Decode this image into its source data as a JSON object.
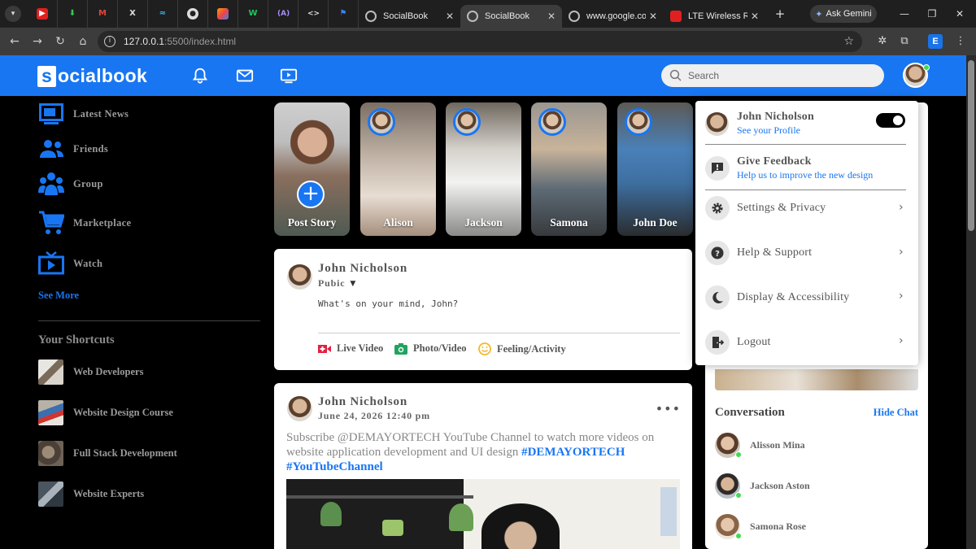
{
  "browser": {
    "tabs": [
      {
        "title": "SocialBook",
        "active": false
      },
      {
        "title": "SocialBook",
        "active": true
      },
      {
        "title": "www.google.com",
        "active": false
      },
      {
        "title": "LTE Wireless Rou",
        "active": false
      }
    ],
    "gemini_label": "Ask Gemini",
    "url_host": "127.0.0.1",
    "url_path": ":5500/index.html",
    "profile_letter": "E"
  },
  "nav": {
    "logo_letter": "s",
    "logo_rest": "ocialbook",
    "search_placeholder": "Search"
  },
  "sidebar": {
    "links": [
      {
        "label": "Latest News",
        "icon": "news-icon"
      },
      {
        "label": "Friends",
        "icon": "friends-icon"
      },
      {
        "label": "Group",
        "icon": "group-icon"
      },
      {
        "label": "Marketplace",
        "icon": "cart-icon"
      },
      {
        "label": "Watch",
        "icon": "watch-icon"
      }
    ],
    "see_more": "See More",
    "shortcuts_title": "Your Shortcuts",
    "shortcuts": [
      {
        "label": "Web Developers"
      },
      {
        "label": "Website Design Course"
      },
      {
        "label": "Full Stack Development"
      },
      {
        "label": "Website Experts"
      }
    ]
  },
  "stories": [
    {
      "name": "Post Story"
    },
    {
      "name": "Alison"
    },
    {
      "name": "Jackson"
    },
    {
      "name": "Samona"
    },
    {
      "name": "John Doe"
    }
  ],
  "composer": {
    "user": "John Nicholson",
    "privacy": "Pubic",
    "placeholder": "What's on your mind, John?",
    "actions": [
      {
        "label": "Live Video",
        "color": "#e41e3f"
      },
      {
        "label": "Photo/Video",
        "color": "#21a35f"
      },
      {
        "label": "Feeling/Activity",
        "color": "#f5b928"
      }
    ]
  },
  "post": {
    "user": "John Nicholson",
    "date": "June 24, 2026 12:40 pm",
    "text": "Subscribe @DEMAYORTECH YouTube Channel to watch more videos on website application development and UI design ",
    "tag1": "#DEMAYORTECH",
    "tag2": "#YouTubeChannel",
    "more": "•••"
  },
  "conversation": {
    "title": "Conversation",
    "hide_label": "Hide Chat",
    "contacts": [
      {
        "name": "Alisson Mina"
      },
      {
        "name": "Jackson Aston"
      },
      {
        "name": "Samona Rose"
      }
    ]
  },
  "menu": {
    "profile_name": "John Nicholson",
    "profile_link": "See your Profile",
    "dark_mode_on": true,
    "feedback_title": "Give Feedback",
    "feedback_sub": "Help us to improve the new design",
    "items": [
      {
        "label": "Settings & Privacy",
        "icon": "gear-icon"
      },
      {
        "label": "Help & Support",
        "icon": "help-icon"
      },
      {
        "label": "Display & Accessibility",
        "icon": "moon-icon"
      },
      {
        "label": "Logout",
        "icon": "logout-icon"
      }
    ]
  },
  "colors": {
    "brand": "#1876f2",
    "online": "#41db51"
  }
}
